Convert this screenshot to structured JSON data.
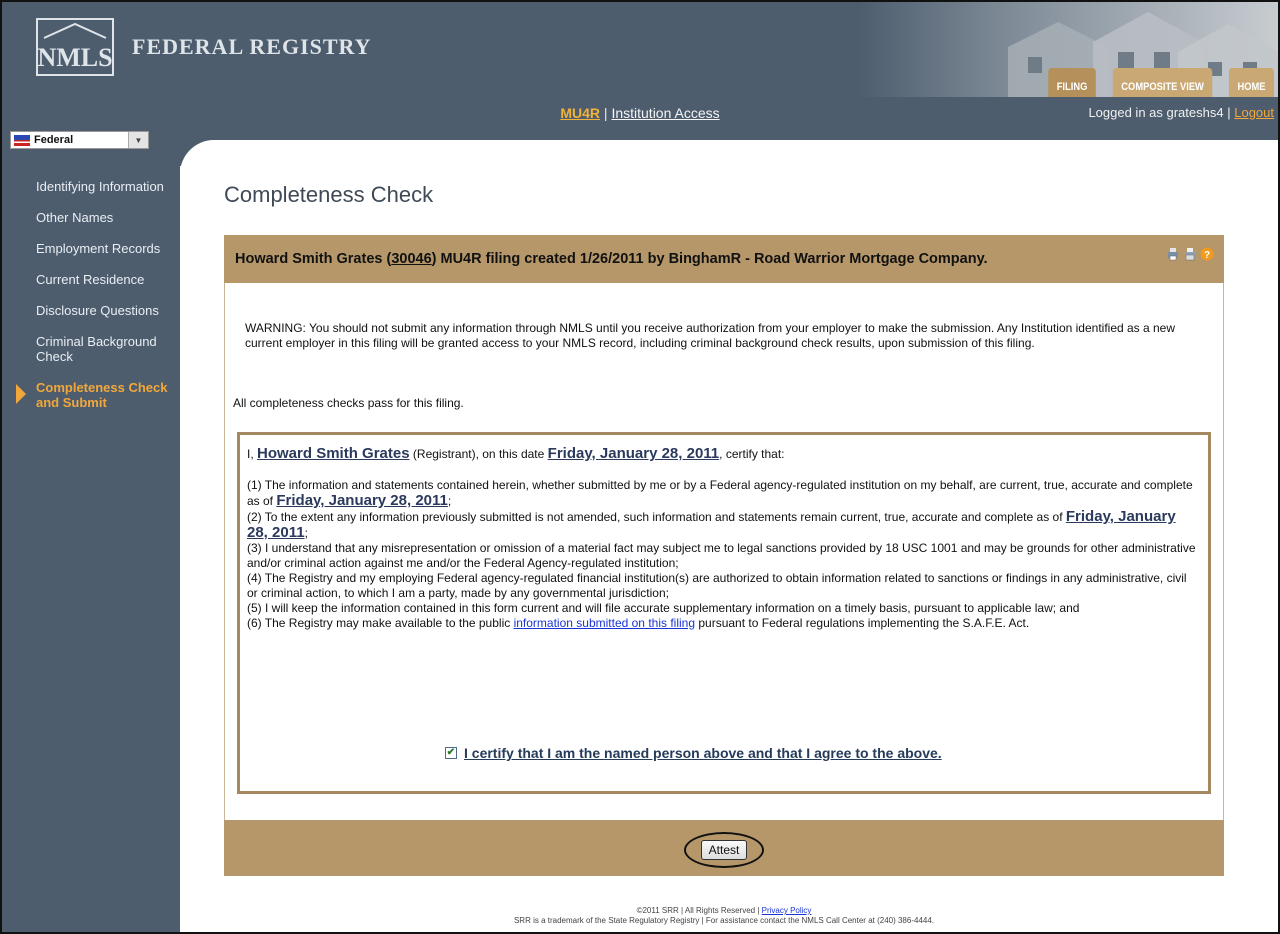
{
  "header": {
    "logo_text": "NMLS",
    "registry_label": "FEDERAL REGISTRY",
    "tabs": [
      {
        "label": "FILING",
        "active": true
      },
      {
        "label": "COMPOSITE VIEW",
        "active": false
      },
      {
        "label": "HOME",
        "active": false
      }
    ]
  },
  "subheader": {
    "form_link": "MU4R",
    "separator": "|",
    "access_link": "Institution Access",
    "logged_in_text": "Logged in as grateshs4",
    "logged_sep": "|",
    "logout_label": "Logout"
  },
  "sidebar": {
    "jurisdiction_select": "Federal",
    "items": [
      {
        "label": "Identifying Information"
      },
      {
        "label": "Other Names"
      },
      {
        "label": "Employment Records"
      },
      {
        "label": "Current Residence"
      },
      {
        "label": "Disclosure Questions"
      },
      {
        "label": "Criminal Background Check"
      },
      {
        "label": "Completeness Check and Submit"
      }
    ]
  },
  "main": {
    "page_title": "Completeness Check",
    "panel_title_prefix": "Howard Smith Grates (",
    "panel_title_num": "30046",
    "panel_title_suffix": ") MU4R filing created 1/26/2011 by BinghamR - Road Warrior Mortgage Company.",
    "warning": "WARNING: You should not submit any information through NMLS until you receive authorization from your employer to make the submission. Any Institution identified as a new current employer in this filing will be granted access to your NMLS record, including criminal background check results, upon submission of this filing.",
    "all_pass": "All completeness checks pass for this filing.",
    "cert_i": "I,",
    "registrant_name": "Howard Smith Grates",
    "registrant_tag": "(Registrant), on this date",
    "cert_date": "Friday, January 28, 2011",
    "certify_that": ", certify that:",
    "item1_a": "(1) The information and statements contained herein, whether submitted by me or by a Federal agency-regulated institution on my behalf, are current, true, accurate and complete as of",
    "item1_date": "Friday, January 28, 2011",
    "item1_end": ";",
    "item2_a": "(2) To the extent any information previously submitted is not amended, such information and statements remain current, true, accurate and complete as of",
    "item2_date": "Friday, January 28, 2011",
    "item2_end": ";",
    "item3": "(3) I understand that any misrepresentation or omission of a material fact may subject me to legal sanctions provided by 18 USC 1001 and may be grounds for other administrative and/or criminal action against me and/or the Federal Agency-regulated institution;",
    "item4": "(4) The Registry and my employing Federal agency-regulated financial institution(s) are authorized to obtain information related to sanctions or findings in any administrative, civil or criminal action, to which I am a party, made by any governmental jurisdiction;",
    "item5": "(5) I will keep the information contained in this form current and will file accurate supplementary information on a timely basis, pursuant to applicable law; and",
    "item6_a": "(6) The Registry may make available to the public",
    "item6_link": "information submitted on this filing",
    "item6_b": "pursuant to Federal regulations implementing the S.A.F.E. Act.",
    "agree_label": "I certify that I am the named person above and that I agree to the above.",
    "agree_checked": true,
    "attest_button": "Attest"
  },
  "footer": {
    "line1_a": "©2011 SRR | All Rights Reserved |",
    "privacy": "Privacy Policy",
    "line2": "SRR is a trademark of the State Regulatory Registry | For assistance contact the NMLS Call Center at (240) 386-4444."
  },
  "colors": {
    "header_bg": "#4d5d6e",
    "tan": "#b5976a",
    "accent_orange": "#f2a73a",
    "link_blue": "#1a34d6"
  }
}
